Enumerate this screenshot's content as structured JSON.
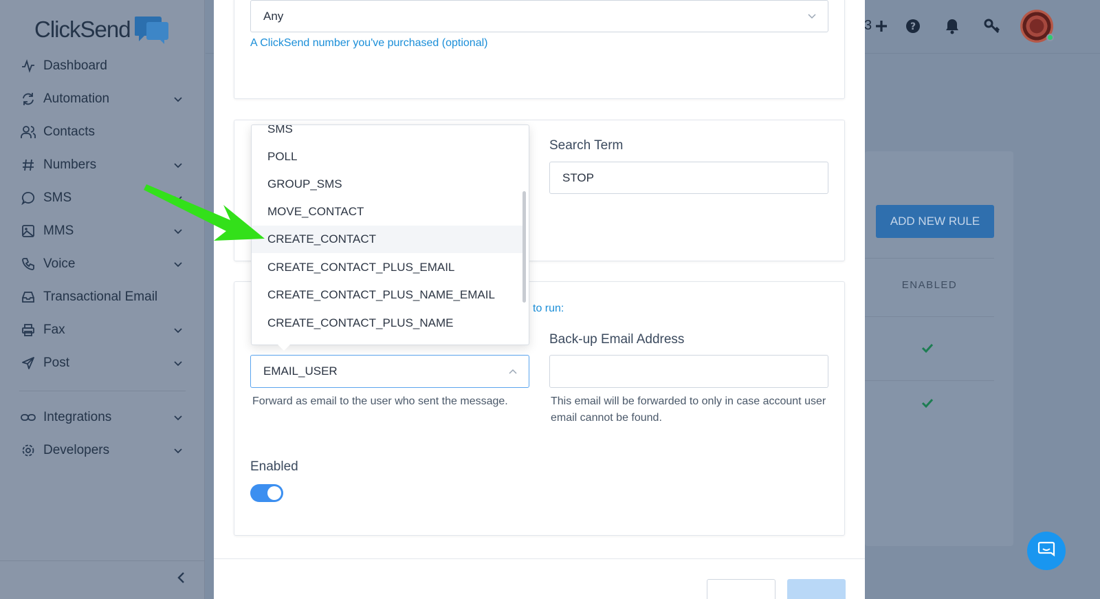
{
  "brand": {
    "name": "ClickSend"
  },
  "sidebar": {
    "items": [
      {
        "label": "Dashboard",
        "icon": "activity-icon",
        "chevron": false
      },
      {
        "label": "Automation",
        "icon": "refresh-icon",
        "chevron": true
      },
      {
        "label": "Contacts",
        "icon": "users-icon",
        "chevron": false
      },
      {
        "label": "Numbers",
        "icon": "hash-icon",
        "chevron": true
      },
      {
        "label": "SMS",
        "icon": "chat-icon",
        "chevron": true
      },
      {
        "label": "MMS",
        "icon": "image-icon",
        "chevron": true
      },
      {
        "label": "Voice",
        "icon": "phone-icon",
        "chevron": true
      },
      {
        "label": "Transactional Email",
        "icon": "inbox-icon",
        "chevron": false
      },
      {
        "label": "Fax",
        "icon": "printer-icon",
        "chevron": true
      },
      {
        "label": "Post",
        "icon": "send-icon",
        "chevron": true
      }
    ],
    "secondary": [
      {
        "label": "Integrations",
        "icon": "link-icon",
        "chevron": true
      },
      {
        "label": "Developers",
        "icon": "gear-icon",
        "chevron": true
      }
    ]
  },
  "header": {
    "credits_partial": "3"
  },
  "background": {
    "add_rule_label": "ADD NEW RULE",
    "enabled_column": "ENABLED"
  },
  "modal": {
    "dedicated_number": {
      "value": "Any",
      "help": "A ClickSend number you've purchased (optional)"
    },
    "search_term": {
      "label": "Search Term",
      "value": "STOP"
    },
    "action": {
      "partial_label": "to run:",
      "value": "EMAIL_USER",
      "help": "Forward as email to the user who sent the message."
    },
    "backup_email": {
      "label": "Back-up Email Address",
      "value": "",
      "help": "This email will be forwarded to only in case account user email cannot be found."
    },
    "enabled": {
      "label": "Enabled",
      "on": true
    },
    "dropdown_options": [
      "SMS",
      "POLL",
      "GROUP_SMS",
      "MOVE_CONTACT",
      "CREATE_CONTACT",
      "CREATE_CONTACT_PLUS_EMAIL",
      "CREATE_CONTACT_PLUS_NAME_EMAIL",
      "CREATE_CONTACT_PLUS_NAME"
    ],
    "highlighted_option": "CREATE_CONTACT"
  },
  "colors": {
    "accent": "#1a8ed8",
    "toggle_on": "#3c8ff0",
    "annotation_arrow": "#33e01a",
    "check_green": "#1d7d52"
  }
}
